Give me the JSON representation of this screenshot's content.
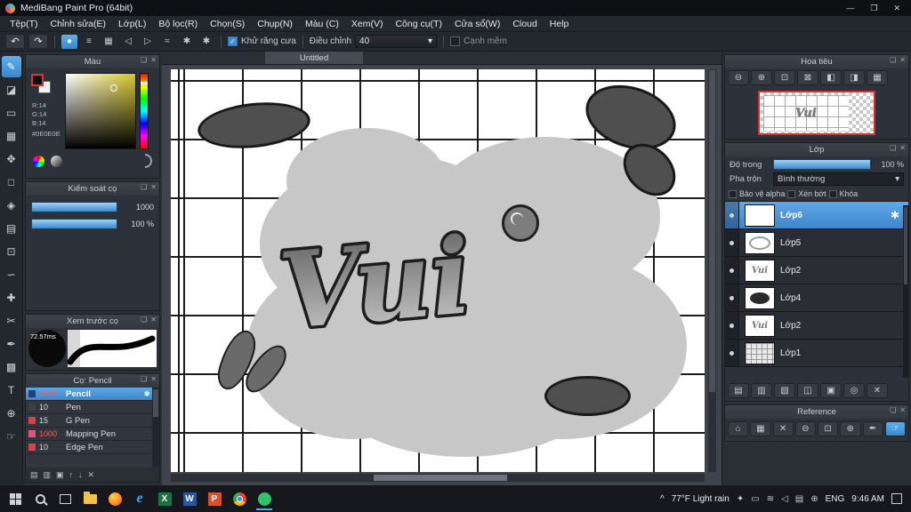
{
  "colors": {
    "accent": "#3f8fd6",
    "selection_blue": "#4f9ad8",
    "navigator_border_red": "#d83030",
    "foreground_color": "#0E0E0E"
  },
  "titlebar": {
    "title": "MediBang Paint Pro (64bit)",
    "minimize_glyph": "—",
    "maximize_glyph": "❐",
    "close_glyph": "✕"
  },
  "menu": {
    "items": [
      "Tệp(T)",
      "Chỉnh sửa(E)",
      "Lớp(L)",
      "Bộ lọc(R)",
      "Chọn(S)",
      "Chụp(N)",
      "Màu (C)",
      "Xem(V)",
      "Công cụ(T)",
      "Cửa sổ(W)",
      "Cloud",
      "Help"
    ]
  },
  "ui": {
    "popout_glyph": "❏",
    "close_glyph": "✕",
    "caret": "▾",
    "check_glyph": "✓"
  },
  "toolbar": {
    "undo_glyph": "↶",
    "redo_glyph": "↷",
    "options": [
      {
        "name": "brush-shape",
        "glyph": "●"
      },
      {
        "name": "stroke-lines",
        "glyph": "≡"
      },
      {
        "name": "tone-grid",
        "glyph": "▦"
      },
      {
        "name": "taper-start",
        "glyph": "◁"
      },
      {
        "name": "taper-end",
        "glyph": "▷"
      },
      {
        "name": "curve",
        "glyph": "≈"
      },
      {
        "name": "gear-a",
        "glyph": "✱"
      },
      {
        "name": "gear-b",
        "glyph": "✱"
      }
    ],
    "antialias_label": "Khử răng cưa",
    "adjust_label": "Điều chỉnh",
    "adjust_value": "40",
    "soft_edge_label": "Cạnh mềm"
  },
  "toolstrip": {
    "icons": [
      {
        "name": "brush-tool",
        "glyph": "✎"
      },
      {
        "name": "eraser-tool",
        "glyph": "◪"
      },
      {
        "name": "rectangle-tool",
        "glyph": "▭"
      },
      {
        "name": "tone-tool",
        "glyph": "▦"
      },
      {
        "name": "move-tool",
        "glyph": "✥"
      },
      {
        "name": "marquee-tool",
        "glyph": "□"
      },
      {
        "name": "bucket-tool",
        "glyph": "◈"
      },
      {
        "name": "gradient-tool",
        "glyph": "▤"
      },
      {
        "name": "select-pen-tool",
        "glyph": "⊡"
      },
      {
        "name": "lasso-tool",
        "glyph": "∽"
      },
      {
        "name": "operation-tool",
        "glyph": "✚"
      },
      {
        "name": "divide-tool",
        "glyph": "✂"
      },
      {
        "name": "eyedropper-tool",
        "glyph": "✒"
      },
      {
        "name": "grid-tool",
        "glyph": "▩"
      },
      {
        "name": "text-tool",
        "glyph": "T"
      },
      {
        "name": "zoom-tool",
        "glyph": "⊕"
      },
      {
        "name": "hand-tool",
        "glyph": "☞"
      }
    ]
  },
  "panels": {
    "color": {
      "title": "Màu",
      "r": "R:14",
      "g": "G:14",
      "b": "B:14",
      "hex": "#0E0E0E"
    },
    "brush_control": {
      "title": "Kiểm soát cọ",
      "size_value": "1000",
      "opacity_value": "100 %"
    },
    "preview": {
      "title": "Xem trước cọ",
      "time": "72.57ms"
    },
    "brushes": {
      "title": "Cọ: Pencil",
      "list": [
        {
          "size": "1000",
          "name": "Pencil",
          "swatch": "#24407a",
          "selected": true
        },
        {
          "size": "10",
          "name": "Pen",
          "swatch": "#3a3f47"
        },
        {
          "size": "15",
          "name": "G Pen",
          "swatch": "#d24444"
        },
        {
          "size": "1000",
          "name": "Mapping Pen",
          "swatch": "#e0527a"
        },
        {
          "size": "10",
          "name": "Edge Pen",
          "swatch": "#d24444"
        }
      ],
      "gear_glyph": "✱",
      "ops": [
        {
          "name": "add-brush",
          "glyph": "▤"
        },
        {
          "name": "duplicate-brush",
          "glyph": "▥"
        },
        {
          "name": "brush-folder",
          "glyph": "▣"
        },
        {
          "name": "brush-up",
          "glyph": "↑"
        },
        {
          "name": "brush-down",
          "glyph": "↓"
        },
        {
          "name": "delete-brush",
          "glyph": "✕"
        }
      ]
    },
    "navigator": {
      "title": "Hoa tiêu",
      "buttons": [
        {
          "name": "zoom-out",
          "glyph": "⊖"
        },
        {
          "name": "zoom-in",
          "glyph": "⊕"
        },
        {
          "name": "zoom-fit",
          "glyph": "⊡"
        },
        {
          "name": "zoom-100",
          "glyph": "⊠"
        },
        {
          "name": "flip-horizontal",
          "glyph": "◧"
        },
        {
          "name": "flip-vertical",
          "glyph": "◨"
        },
        {
          "name": "rotate-reset",
          "glyph": "▦"
        }
      ]
    },
    "layers": {
      "title": "Lớp",
      "opacity_label": "Độ trong",
      "opacity_value": "100 %",
      "blend_label": "Pha trộn",
      "blend_value": "Bình thường",
      "protect_alpha": "Bảo vệ alpha",
      "clip": "Xén bớt",
      "lock": "Khóa",
      "gear_glyph": "✱",
      "items": [
        {
          "name": "Lớp6",
          "selected": true
        },
        {
          "name": "Lớp5"
        },
        {
          "name": "Lớp2"
        },
        {
          "name": "Lớp4"
        },
        {
          "name": "Lớp2"
        },
        {
          "name": "Lớp1"
        }
      ],
      "ops": [
        {
          "name": "new-layer",
          "glyph": "▤"
        },
        {
          "name": "duplicate-layer",
          "glyph": "▥"
        },
        {
          "name": "merge-layer",
          "glyph": "▧"
        },
        {
          "name": "transfer-layer",
          "glyph": "◫"
        },
        {
          "name": "new-folder",
          "glyph": "▣"
        },
        {
          "name": "layer-camera",
          "glyph": "◎"
        },
        {
          "name": "delete-layer",
          "glyph": "✕"
        }
      ]
    },
    "reference": {
      "title": "Reference",
      "buttons": [
        {
          "name": "ref-home",
          "glyph": "⌂"
        },
        {
          "name": "ref-checker",
          "glyph": "▦"
        },
        {
          "name": "ref-clear",
          "glyph": "✕"
        },
        {
          "name": "ref-zoom-out",
          "glyph": "⊖"
        },
        {
          "name": "ref-fit",
          "glyph": "⊡"
        },
        {
          "name": "ref-zoom-in",
          "glyph": "⊕"
        },
        {
          "name": "ref-eyedropper",
          "glyph": "✒"
        },
        {
          "name": "ref-hand",
          "glyph": "☞",
          "active": true
        }
      ]
    }
  },
  "canvas": {
    "tab": "Untitled",
    "artwork_text": "Vui"
  },
  "taskbar": {
    "caret": "^",
    "weather": "77°F Light rain",
    "lang": "ENG",
    "time": "9:46 AM",
    "apps": [
      {
        "name": "edge",
        "letter": "e"
      },
      {
        "name": "excel",
        "letter": "X"
      },
      {
        "name": "word",
        "letter": "W"
      },
      {
        "name": "powerpoint",
        "letter": "P"
      }
    ],
    "tray": [
      {
        "name": "pen-icon",
        "glyph": "✦"
      },
      {
        "name": "battery-icon",
        "glyph": "▭"
      },
      {
        "name": "network-icon",
        "glyph": "≋"
      },
      {
        "name": "volume-icon",
        "glyph": "◁"
      },
      {
        "name": "keyboard-icon",
        "glyph": "▤"
      },
      {
        "name": "globe-icon",
        "glyph": "⊕"
      }
    ]
  }
}
